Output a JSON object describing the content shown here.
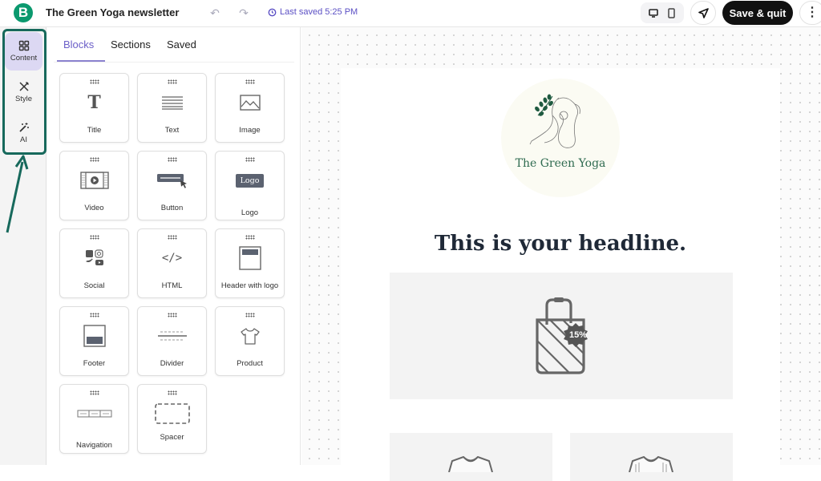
{
  "topbar": {
    "brand_letter": "B",
    "doc_title": "The Green Yoga newsletter",
    "last_saved": "Last saved 5:25 PM",
    "save_quit_label": "Save & quit",
    "more_label": "⋮"
  },
  "rail": {
    "items": [
      {
        "label": "Content",
        "icon": "grid-icon",
        "active": true
      },
      {
        "label": "Style",
        "icon": "brush-pencil-icon",
        "active": false
      },
      {
        "label": "AI",
        "icon": "magic-wand-icon",
        "active": false
      }
    ],
    "accent_color": "#17695c"
  },
  "panel": {
    "tabs": [
      {
        "label": "Blocks",
        "active": true
      },
      {
        "label": "Sections",
        "active": false
      },
      {
        "label": "Saved",
        "active": false
      }
    ],
    "blocks": [
      {
        "label": "Title"
      },
      {
        "label": "Text"
      },
      {
        "label": "Image"
      },
      {
        "label": "Video"
      },
      {
        "label": "Button"
      },
      {
        "label": "Logo"
      },
      {
        "label": "Social"
      },
      {
        "label": "HTML"
      },
      {
        "label": "Header with logo"
      },
      {
        "label": "Footer"
      },
      {
        "label": "Divider"
      },
      {
        "label": "Product"
      },
      {
        "label": "Navigation"
      },
      {
        "label": "Spacer"
      }
    ],
    "logo_icon_text": "Logo",
    "html_icon_text": "</>"
  },
  "email": {
    "logo_text": "The Green Yoga",
    "headline": "This is your headline.",
    "discount_badge": "15%"
  },
  "colors": {
    "accent_purple": "#6b5fc8",
    "brand_green": "#0b996e",
    "annotation_teal": "#17695c"
  }
}
